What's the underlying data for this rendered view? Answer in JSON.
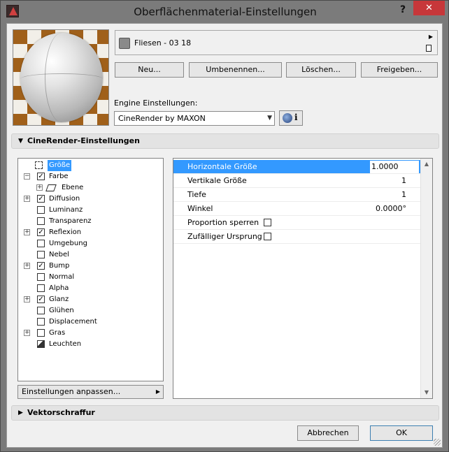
{
  "window": {
    "title": "Oberflächenmaterial-Einstellungen",
    "help_label": "?",
    "close_label": "✕"
  },
  "material": {
    "name": "Fliesen - 03 18",
    "swatch_color": "#8a8a8a"
  },
  "actions": {
    "new_label": "Neu...",
    "rename_label": "Umbenennen...",
    "delete_label": "Löschen...",
    "share_label": "Freigeben..."
  },
  "engine": {
    "label": "Engine Einstellungen:",
    "selected": "CineRender by MAXON",
    "info_label": "i"
  },
  "sections": {
    "cinerender": "CineRender-Einstellungen",
    "vector_hatch": "Vektorschraffur"
  },
  "channels": [
    {
      "label": "Größe",
      "checked": false,
      "expandable": false,
      "selected": true
    },
    {
      "label": "Farbe",
      "checked": true,
      "expandable": true,
      "expanded": true
    },
    {
      "label": "Ebene",
      "sub": true
    },
    {
      "label": "Diffusion",
      "checked": true,
      "expandable": true
    },
    {
      "label": "Luminanz",
      "checked": false,
      "expandable": false
    },
    {
      "label": "Transparenz",
      "checked": false,
      "expandable": false
    },
    {
      "label": "Reflexion",
      "checked": true,
      "expandable": true
    },
    {
      "label": "Umgebung",
      "checked": false,
      "expandable": false
    },
    {
      "label": "Nebel",
      "checked": false,
      "expandable": false
    },
    {
      "label": "Bump",
      "checked": true,
      "expandable": true
    },
    {
      "label": "Normal",
      "checked": false,
      "expandable": false
    },
    {
      "label": "Alpha",
      "checked": false,
      "expandable": false
    },
    {
      "label": "Glanz",
      "checked": true,
      "expandable": true
    },
    {
      "label": "Glühen",
      "checked": false,
      "expandable": false
    },
    {
      "label": "Displacement",
      "checked": false,
      "expandable": false
    },
    {
      "label": "Gras",
      "checked": false,
      "expandable": true
    },
    {
      "label": "Leuchten",
      "leaf": true
    }
  ],
  "customize_label": "Einstellungen anpassen...",
  "properties": [
    {
      "label": "Horizontale Größe",
      "value": "1.0000",
      "selected": true
    },
    {
      "label": "Vertikale Größe",
      "value": "1"
    },
    {
      "label": "Tiefe",
      "value": "1"
    },
    {
      "label": "Winkel",
      "value": "0.0000°"
    },
    {
      "label": "Proportion sperren",
      "checkbox": true
    },
    {
      "label": "Zufälliger Ursprung",
      "checkbox": true
    }
  ],
  "footer": {
    "cancel_label": "Abbrechen",
    "ok_label": "OK"
  }
}
